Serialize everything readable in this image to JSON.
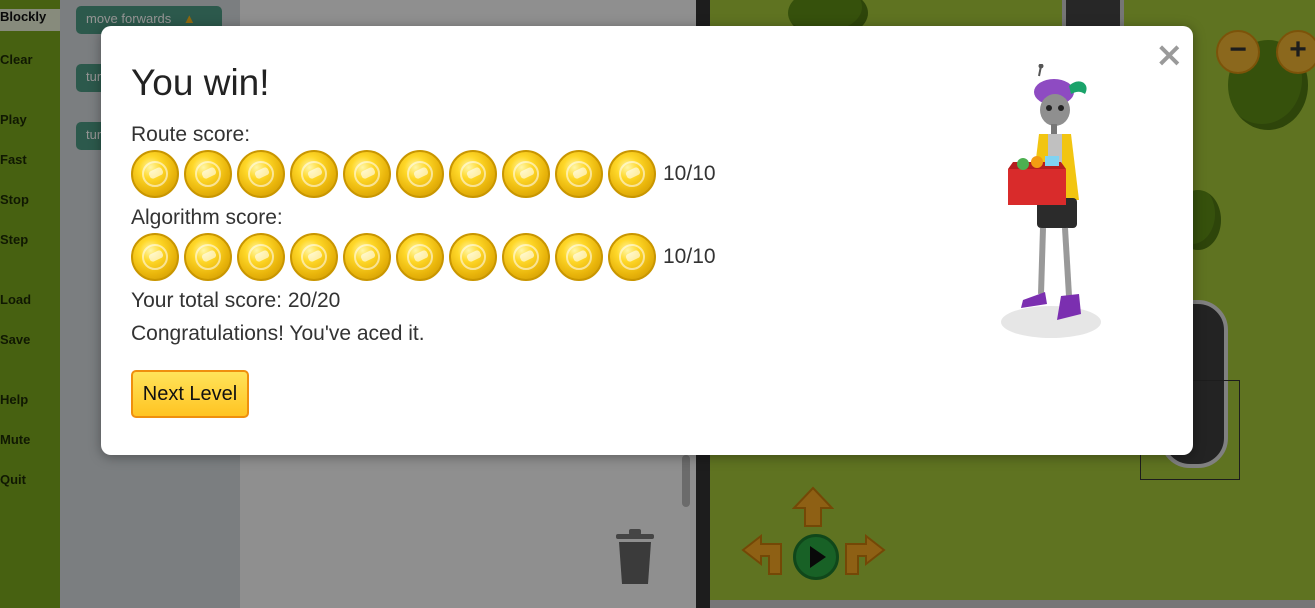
{
  "sidebar": {
    "items": [
      {
        "label": "Blockly",
        "active": true
      },
      {
        "label": "Clear"
      },
      {
        "label": "Play"
      },
      {
        "label": "Fast"
      },
      {
        "label": "Stop"
      },
      {
        "label": "Step"
      },
      {
        "label": "Load"
      },
      {
        "label": "Save"
      },
      {
        "label": "Help"
      },
      {
        "label": "Mute"
      },
      {
        "label": "Quit"
      }
    ]
  },
  "toolbox": {
    "blocks": [
      {
        "label": "move forwards"
      },
      {
        "label": "tur"
      },
      {
        "label": "tur"
      }
    ]
  },
  "map": {
    "zoom_out": "−",
    "zoom_in": "+"
  },
  "modal": {
    "title": "You win!",
    "close_label": "×",
    "route_label": "Route score:",
    "route_score": "10/10",
    "route_coins": 10,
    "algorithm_label": "Algorithm score:",
    "algorithm_score": "10/10",
    "algorithm_coins": 10,
    "total_label": "Your total score: 20/20",
    "message": "Congratulations! You've aced it.",
    "next_button": "Next Level"
  },
  "colors": {
    "coin": "#f5c518",
    "button": "#ffd23f",
    "button_border": "#ef8f0e",
    "sidebar": "#7aa81e",
    "map": "#a4c639"
  }
}
